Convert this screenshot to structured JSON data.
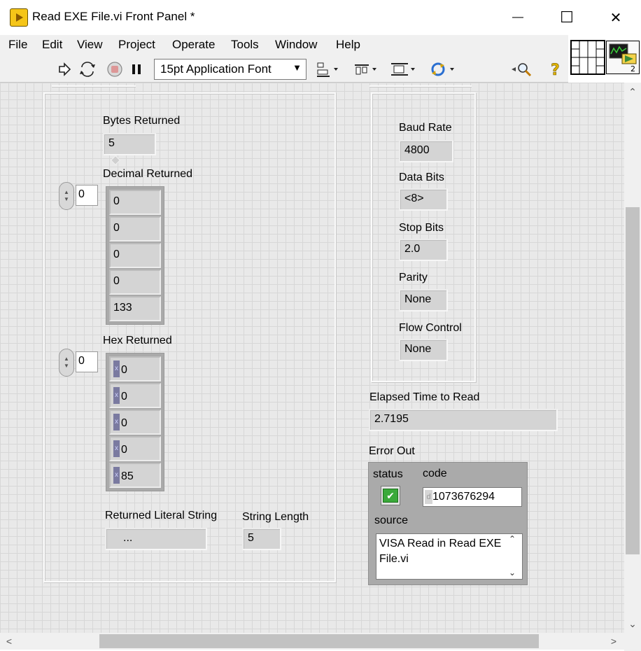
{
  "window": {
    "title": "Read EXE File.vi Front Panel *",
    "minimize": "—",
    "maximize": "☐",
    "close": "✕"
  },
  "menu": [
    "File",
    "Edit",
    "View",
    "Project",
    "Operate",
    "Tools",
    "Window",
    "Help"
  ],
  "toolbar": {
    "font_select": "15pt Application Font",
    "icons": [
      "run-arrow-icon",
      "run-continuously-icon",
      "abort-icon",
      "pause-icon",
      "align-objects-icon",
      "distribute-objects-icon",
      "resize-objects-icon",
      "reorder-icon",
      "search-icon",
      "help-icon"
    ]
  },
  "connector": {
    "terminal_number": "2"
  },
  "panel": {
    "bytes_returned": {
      "label": "Bytes Returned",
      "value": "5"
    },
    "decimal_returned": {
      "label": "Decimal Returned",
      "index": "0",
      "values": [
        "0",
        "0",
        "0",
        "0",
        "133"
      ]
    },
    "hex_returned": {
      "label": "Hex Returned",
      "index": "0",
      "radix": "x",
      "values": [
        "0",
        "0",
        "0",
        "0",
        "85"
      ]
    },
    "returned_literal_string": {
      "label": "Returned Literal String",
      "value": "..."
    },
    "string_length": {
      "label": "String Length",
      "value": "5"
    },
    "baud_rate": {
      "label": "Baud Rate",
      "value": "4800"
    },
    "data_bits": {
      "label": "Data Bits",
      "value": "<8>"
    },
    "stop_bits": {
      "label": "Stop Bits",
      "value": "2.0"
    },
    "parity": {
      "label": "Parity",
      "value": "None"
    },
    "flow_control": {
      "label": "Flow Control",
      "value": "None"
    },
    "elapsed_time": {
      "label": "Elapsed Time to Read",
      "value": "2.7195"
    },
    "error_out": {
      "label": "Error Out",
      "status_label": "status",
      "status_check": "✔",
      "code_label": "code",
      "code_radix": "d",
      "code_value": "1073676294",
      "source_label": "source",
      "source_value": "VISA Read in Read EXE File.vi"
    }
  },
  "scroll": {
    "up": "⌃",
    "down": "⌄",
    "left": "<",
    "right": ">"
  }
}
